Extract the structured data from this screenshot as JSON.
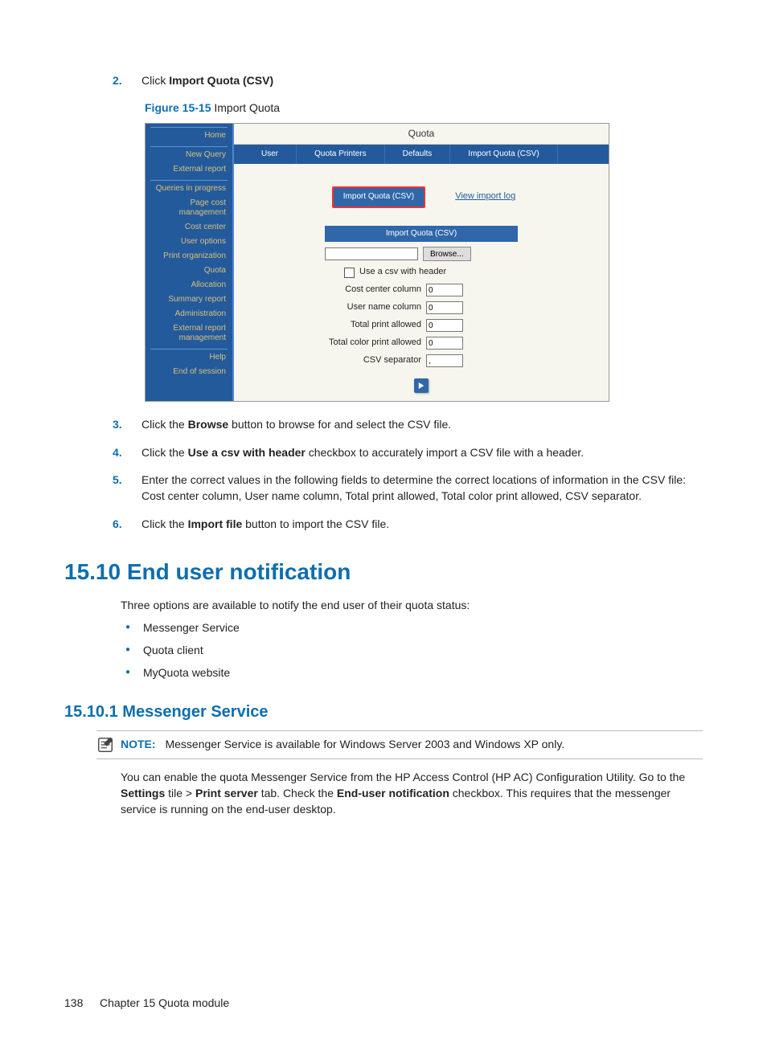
{
  "steps": {
    "s2": {
      "num": "2.",
      "pre": "Click ",
      "bold": "Import Quota (CSV)"
    },
    "s3": {
      "num": "3.",
      "pre": "Click the ",
      "bold": "Browse",
      "post": " button to browse for and select the CSV file."
    },
    "s4": {
      "num": "4.",
      "pre": "Click the ",
      "bold": "Use a csv with header",
      "post": " checkbox to accurately import a CSV file with a header."
    },
    "s5": {
      "num": "5.",
      "text": "Enter the correct values in the following fields to determine the correct locations of information in the CSV file: Cost center column, User name column, Total print allowed, Total color print allowed, CSV separator."
    },
    "s6": {
      "num": "6.",
      "pre": "Click the ",
      "bold": "Import file",
      "post": " button to import the CSV file."
    }
  },
  "figure": {
    "ref": "Figure 15-15",
    "caption": "  Import Quota"
  },
  "screenshot": {
    "sidebar": {
      "items": [
        "Home",
        "New Query",
        "External report",
        "Queries in progress",
        "Page cost management",
        "Cost center",
        "User options",
        "Print organization",
        "Quota",
        "Allocation",
        "Summary report",
        "Administration",
        "External report management",
        "Help",
        "End of session"
      ]
    },
    "title": "Quota",
    "tabs": [
      "User",
      "Quota Printers",
      "Defaults",
      "Import Quota (CSV)"
    ],
    "actions": {
      "import_btn": "Import Quota (CSV)",
      "view_log": "View import log"
    },
    "import_box": {
      "title": "Import Quota (CSV)",
      "browse": "Browse...",
      "use_header": "Use a csv with header",
      "cost_center": {
        "label": "Cost center column",
        "value": "0"
      },
      "user_name": {
        "label": "User name column",
        "value": "0"
      },
      "total_print": {
        "label": "Total print allowed",
        "value": "0"
      },
      "total_color": {
        "label": "Total color print allowed",
        "value": "0"
      },
      "separator": {
        "label": "CSV separator",
        "value": ","
      }
    }
  },
  "section": {
    "heading": "15.10 End user notification",
    "intro": "Three options are available to notify the end user of their quota status:",
    "bullets": [
      "Messenger Service",
      "Quota client",
      "MyQuota website"
    ]
  },
  "subsection": {
    "heading": "15.10.1 Messenger Service",
    "note_label": "NOTE:",
    "note_text": "Messenger Service is available for Windows Server 2003 and Windows XP only.",
    "para_pre": "You can enable the quota Messenger Service from the HP Access Control (HP AC) Configuration Utility. Go to the ",
    "bold1": "Settings",
    "mid1": " tile > ",
    "bold2": "Print server",
    "mid2": " tab. Check the ",
    "bold3": "End-user notification",
    "post": " checkbox. This requires that the messenger service is running on the end-user desktop."
  },
  "footer": {
    "page": "138",
    "chapter": "Chapter 15   Quota module"
  }
}
